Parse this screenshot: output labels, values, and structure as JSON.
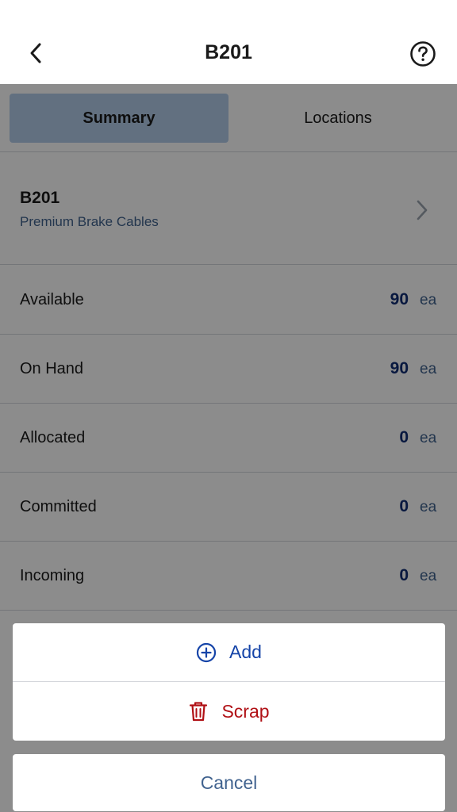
{
  "header": {
    "title": "B201",
    "back_icon": "chevron-left-icon",
    "help_icon": "question-circle-icon"
  },
  "tabs": [
    {
      "label": "Summary",
      "active": true
    },
    {
      "label": "Locations",
      "active": false
    }
  ],
  "item": {
    "code": "B201",
    "description": "Premium Brake Cables"
  },
  "quantities": [
    {
      "label": "Available",
      "value": "90",
      "unit": "ea"
    },
    {
      "label": "On Hand",
      "value": "90",
      "unit": "ea"
    },
    {
      "label": "Allocated",
      "value": "0",
      "unit": "ea"
    },
    {
      "label": "Committed",
      "value": "0",
      "unit": "ea"
    },
    {
      "label": "Incoming",
      "value": "0",
      "unit": "ea"
    }
  ],
  "action_sheet": {
    "add_label": "Add",
    "scrap_label": "Scrap",
    "cancel_label": "Cancel",
    "add_icon": "plus-circle-icon",
    "scrap_icon": "trash-icon"
  },
  "colors": {
    "accent_blue": "#1544a8",
    "destructive_red": "#b01015",
    "tab_active_bg": "#b3ccea",
    "quantity_value": "#102d73"
  }
}
